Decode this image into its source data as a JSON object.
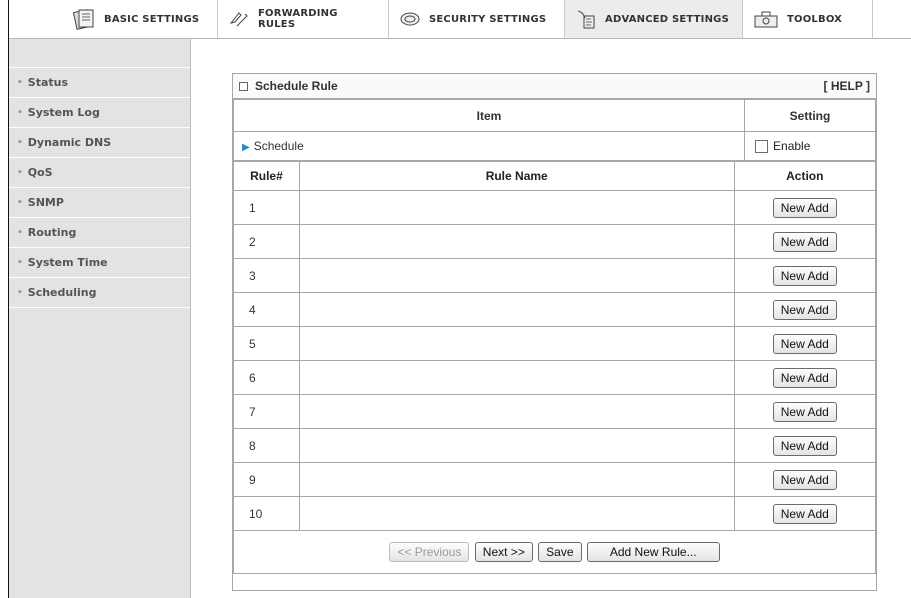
{
  "tabs": [
    {
      "label": "BASIC SETTINGS",
      "icon": "basic-settings-icon",
      "active": false
    },
    {
      "label": "FORWARDING RULES",
      "icon": "forwarding-icon",
      "active": false
    },
    {
      "label": "SECURITY SETTINGS",
      "icon": "security-icon",
      "active": false
    },
    {
      "label": "ADVANCED SETTINGS",
      "icon": "advanced-icon",
      "active": true
    },
    {
      "label": "TOOLBOX",
      "icon": "toolbox-icon",
      "active": false
    }
  ],
  "sidebar": {
    "items": [
      {
        "label": "Status"
      },
      {
        "label": "System Log"
      },
      {
        "label": "Dynamic DNS"
      },
      {
        "label": "QoS"
      },
      {
        "label": "SNMP"
      },
      {
        "label": "Routing"
      },
      {
        "label": "System Time"
      },
      {
        "label": "Scheduling"
      }
    ]
  },
  "panel": {
    "title": "Schedule Rule",
    "help": "[ HELP ]",
    "col_item": "Item",
    "col_setting": "Setting",
    "schedule_label": "Schedule",
    "enable_label": "Enable",
    "rule_col_num": "Rule#",
    "rule_col_name": "Rule Name",
    "rule_col_action": "Action",
    "rules": [
      {
        "num": "1",
        "name": "",
        "action": "New Add"
      },
      {
        "num": "2",
        "name": "",
        "action": "New Add"
      },
      {
        "num": "3",
        "name": "",
        "action": "New Add"
      },
      {
        "num": "4",
        "name": "",
        "action": "New Add"
      },
      {
        "num": "5",
        "name": "",
        "action": "New Add"
      },
      {
        "num": "6",
        "name": "",
        "action": "New Add"
      },
      {
        "num": "7",
        "name": "",
        "action": "New Add"
      },
      {
        "num": "8",
        "name": "",
        "action": "New Add"
      },
      {
        "num": "9",
        "name": "",
        "action": "New Add"
      },
      {
        "num": "10",
        "name": "",
        "action": "New Add"
      }
    ],
    "previous": "<< Previous",
    "next": "Next >>",
    "save": "Save",
    "add_new_rule": "Add New Rule..."
  }
}
